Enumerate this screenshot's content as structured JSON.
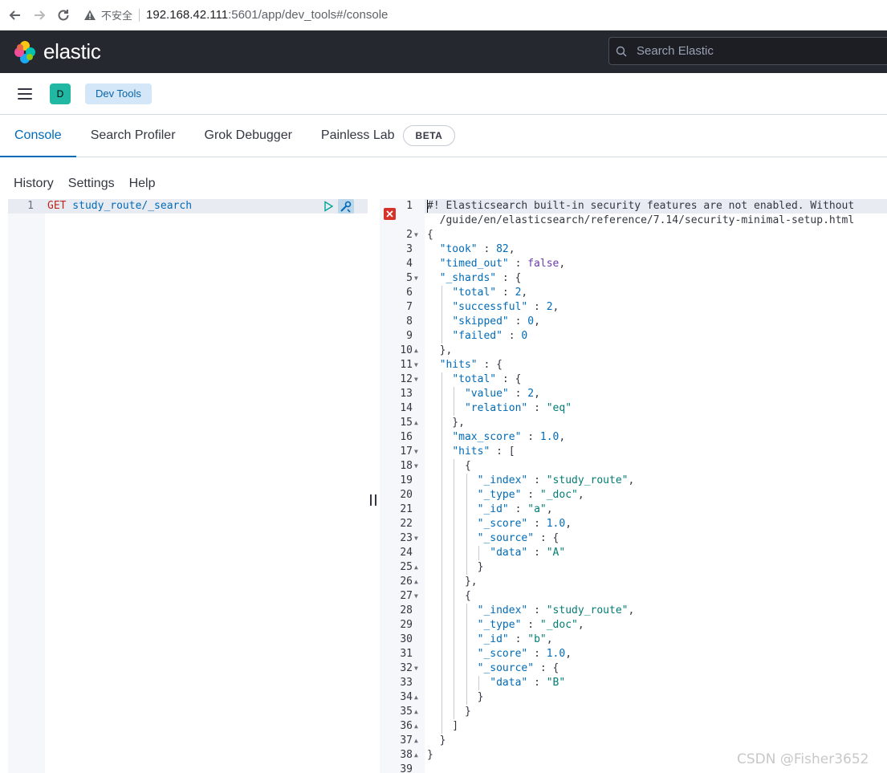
{
  "browser": {
    "insecure_label": "不安全",
    "url_host": "192.168.42.111",
    "url_rest": ":5601/app/dev_tools#/console"
  },
  "header": {
    "brand": "elastic",
    "search_placeholder": "Search Elastic"
  },
  "breadcrumb": {
    "space_initial": "D",
    "current": "Dev Tools"
  },
  "tabs": [
    {
      "label": "Console",
      "active": true
    },
    {
      "label": "Search Profiler"
    },
    {
      "label": "Grok Debugger"
    },
    {
      "label": "Painless Lab",
      "badge": "BETA"
    }
  ],
  "menu": {
    "history": "History",
    "settings": "Settings",
    "help": "Help"
  },
  "request": {
    "line_number": "1",
    "method": "GET",
    "path": " study_route/_search"
  },
  "response": {
    "lines": [
      {
        "n": "1",
        "fold": "",
        "text": "#! Elasticsearch built-in security features are not enabled. Without"
      },
      {
        "n": "",
        "fold": "",
        "text": "  /guide/en/elasticsearch/reference/7.14/security-minimal-setup.html"
      },
      {
        "n": "2",
        "fold": "▼",
        "text": "{"
      },
      {
        "n": "3",
        "fold": "",
        "text": "  \"took\" : 82,"
      },
      {
        "n": "4",
        "fold": "",
        "text": "  \"timed_out\" : false,"
      },
      {
        "n": "5",
        "fold": "▼",
        "text": "  \"_shards\" : {"
      },
      {
        "n": "6",
        "fold": "",
        "text": "    \"total\" : 2,"
      },
      {
        "n": "7",
        "fold": "",
        "text": "    \"successful\" : 2,"
      },
      {
        "n": "8",
        "fold": "",
        "text": "    \"skipped\" : 0,"
      },
      {
        "n": "9",
        "fold": "",
        "text": "    \"failed\" : 0"
      },
      {
        "n": "10",
        "fold": "▲",
        "text": "  },"
      },
      {
        "n": "11",
        "fold": "▼",
        "text": "  \"hits\" : {"
      },
      {
        "n": "12",
        "fold": "▼",
        "text": "    \"total\" : {"
      },
      {
        "n": "13",
        "fold": "",
        "text": "      \"value\" : 2,"
      },
      {
        "n": "14",
        "fold": "",
        "text": "      \"relation\" : \"eq\""
      },
      {
        "n": "15",
        "fold": "▲",
        "text": "    },"
      },
      {
        "n": "16",
        "fold": "",
        "text": "    \"max_score\" : 1.0,"
      },
      {
        "n": "17",
        "fold": "▼",
        "text": "    \"hits\" : ["
      },
      {
        "n": "18",
        "fold": "▼",
        "text": "      {"
      },
      {
        "n": "19",
        "fold": "",
        "text": "        \"_index\" : \"study_route\","
      },
      {
        "n": "20",
        "fold": "",
        "text": "        \"_type\" : \"_doc\","
      },
      {
        "n": "21",
        "fold": "",
        "text": "        \"_id\" : \"a\","
      },
      {
        "n": "22",
        "fold": "",
        "text": "        \"_score\" : 1.0,"
      },
      {
        "n": "23",
        "fold": "▼",
        "text": "        \"_source\" : {"
      },
      {
        "n": "24",
        "fold": "",
        "text": "          \"data\" : \"A\""
      },
      {
        "n": "25",
        "fold": "▲",
        "text": "        }"
      },
      {
        "n": "26",
        "fold": "▲",
        "text": "      },"
      },
      {
        "n": "27",
        "fold": "▼",
        "text": "      {"
      },
      {
        "n": "28",
        "fold": "",
        "text": "        \"_index\" : \"study_route\","
      },
      {
        "n": "29",
        "fold": "",
        "text": "        \"_type\" : \"_doc\","
      },
      {
        "n": "30",
        "fold": "",
        "text": "        \"_id\" : \"b\","
      },
      {
        "n": "31",
        "fold": "",
        "text": "        \"_score\" : 1.0,"
      },
      {
        "n": "32",
        "fold": "▼",
        "text": "        \"_source\" : {"
      },
      {
        "n": "33",
        "fold": "",
        "text": "          \"data\" : \"B\""
      },
      {
        "n": "34",
        "fold": "▲",
        "text": "        }"
      },
      {
        "n": "35",
        "fold": "▲",
        "text": "      }"
      },
      {
        "n": "36",
        "fold": "▲",
        "text": "    ]"
      },
      {
        "n": "37",
        "fold": "▲",
        "text": "  }"
      },
      {
        "n": "38",
        "fold": "▲",
        "text": "}"
      },
      {
        "n": "39",
        "fold": "",
        "text": ""
      }
    ]
  },
  "watermark": "CSDN @Fisher3652",
  "colors": {
    "header_bg": "#25282f",
    "accent": "#006bb8",
    "space_badge": "#20b8a2",
    "error": "#d6322a"
  }
}
